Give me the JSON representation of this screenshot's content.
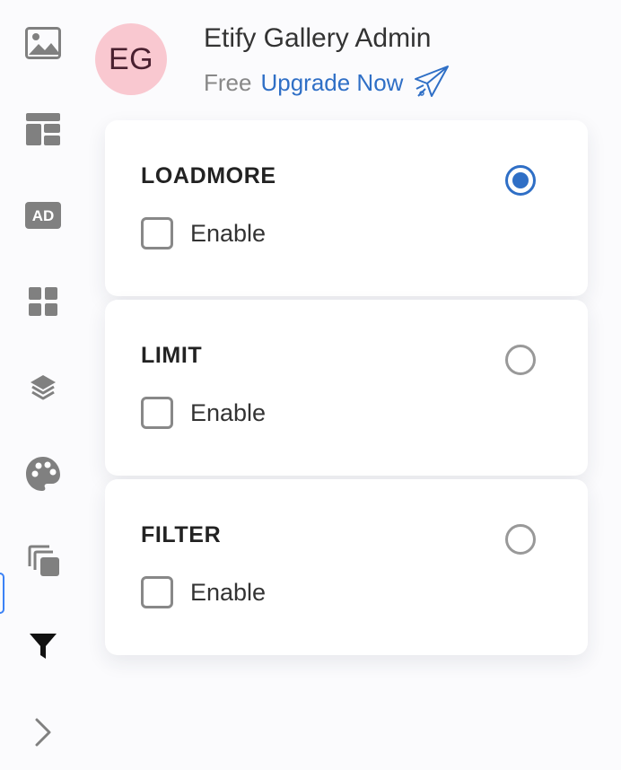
{
  "sidebar": {
    "items": [
      {
        "icon": "image-icon"
      },
      {
        "icon": "layout-icon"
      },
      {
        "icon": "ad-icon",
        "text": "AD"
      },
      {
        "icon": "grid-icon"
      },
      {
        "icon": "layers-icon"
      },
      {
        "icon": "palette-icon"
      },
      {
        "icon": "copy-icon"
      },
      {
        "icon": "filter-icon"
      },
      {
        "icon": "chevron-right-icon"
      }
    ]
  },
  "header": {
    "avatar_initials": "EG",
    "user_name": "Etify Gallery Admin",
    "plan": "Free",
    "upgrade_link": "Upgrade Now"
  },
  "cards": [
    {
      "title": "LOADMORE",
      "selected": true,
      "checkbox_label": "Enable",
      "checked": false
    },
    {
      "title": "LIMIT",
      "selected": false,
      "checkbox_label": "Enable",
      "checked": false
    },
    {
      "title": "FILTER",
      "selected": false,
      "checkbox_label": "Enable",
      "checked": false
    }
  ],
  "colors": {
    "accent": "#2f6fc6",
    "avatar_bg": "#f9c8d0",
    "active_indicator": "#3b82f6"
  }
}
